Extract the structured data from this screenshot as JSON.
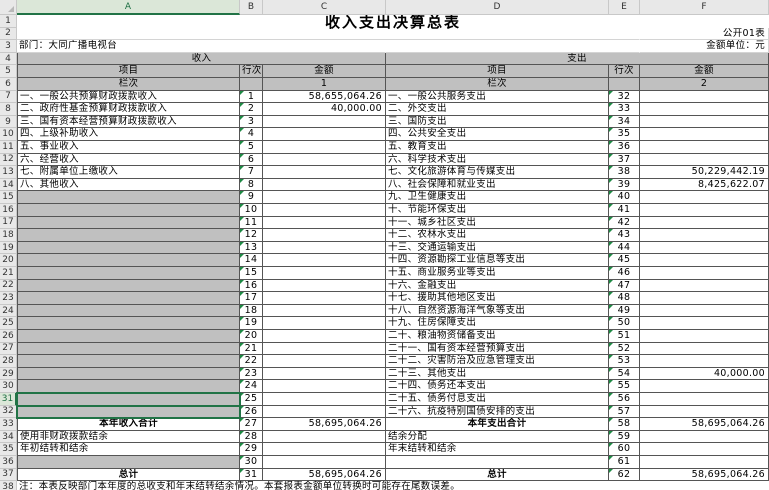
{
  "columns": [
    "A",
    "B",
    "C",
    "D",
    "E",
    "F"
  ],
  "rows": [
    "1",
    "2",
    "3",
    "4",
    "5",
    "6",
    "7",
    "8",
    "9",
    "10",
    "11",
    "12",
    "13",
    "14",
    "15",
    "16",
    "17",
    "18",
    "19",
    "20",
    "21",
    "22",
    "23",
    "24",
    "25",
    "26",
    "27",
    "28",
    "29",
    "30",
    "31",
    "32",
    "33",
    "34",
    "35",
    "36",
    "37",
    "38"
  ],
  "selected_cell": "A31",
  "sheet": {
    "title": "收入支出决算总表",
    "form_code": "公开01表",
    "department": "部门：大同广播电视台",
    "unit": "金额单位：元",
    "income_header": "收入",
    "expense_header": "支出",
    "item_label": "项目",
    "line_label": "行次",
    "amount_label": "金额",
    "column_label": "栏次",
    "income_col_no": "1",
    "expense_col_no": "2",
    "income_rows": [
      {
        "name": "一、一般公共预算财政拨款收入",
        "line": "1",
        "amount": "58,655,064.26"
      },
      {
        "name": "二、政府性基金预算财政拨款收入",
        "line": "2",
        "amount": "40,000.00"
      },
      {
        "name": "三、国有资本经营预算财政拨款收入",
        "line": "3",
        "amount": ""
      },
      {
        "name": "四、上级补助收入",
        "line": "4",
        "amount": ""
      },
      {
        "name": "五、事业收入",
        "line": "5",
        "amount": ""
      },
      {
        "name": "六、经营收入",
        "line": "6",
        "amount": ""
      },
      {
        "name": "七、附属单位上缴收入",
        "line": "7",
        "amount": ""
      },
      {
        "name": "八、其他收入",
        "line": "8",
        "amount": ""
      },
      {
        "name": "",
        "line": "9",
        "amount": ""
      },
      {
        "name": "",
        "line": "10",
        "amount": ""
      },
      {
        "name": "",
        "line": "11",
        "amount": ""
      },
      {
        "name": "",
        "line": "12",
        "amount": ""
      },
      {
        "name": "",
        "line": "13",
        "amount": ""
      },
      {
        "name": "",
        "line": "14",
        "amount": ""
      },
      {
        "name": "",
        "line": "15",
        "amount": ""
      },
      {
        "name": "",
        "line": "16",
        "amount": ""
      },
      {
        "name": "",
        "line": "17",
        "amount": ""
      },
      {
        "name": "",
        "line": "18",
        "amount": ""
      },
      {
        "name": "",
        "line": "19",
        "amount": ""
      },
      {
        "name": "",
        "line": "20",
        "amount": ""
      },
      {
        "name": "",
        "line": "21",
        "amount": ""
      },
      {
        "name": "",
        "line": "22",
        "amount": ""
      },
      {
        "name": "",
        "line": "23",
        "amount": ""
      },
      {
        "name": "",
        "line": "24",
        "amount": ""
      },
      {
        "name": "",
        "line": "25",
        "amount": ""
      },
      {
        "name": "",
        "line": "26",
        "amount": ""
      },
      {
        "name": "本年收入合计",
        "line": "27",
        "amount": "58,695,064.26"
      },
      {
        "name": "使用非财政拨款结余",
        "line": "28",
        "amount": ""
      },
      {
        "name": "年初结转和结余",
        "line": "29",
        "amount": ""
      },
      {
        "name": "",
        "line": "30",
        "amount": ""
      },
      {
        "name": "总计",
        "line": "31",
        "amount": "58,695,064.26"
      }
    ],
    "expense_rows": [
      {
        "name": "一、一般公共服务支出",
        "line": "32",
        "amount": ""
      },
      {
        "name": "二、外交支出",
        "line": "33",
        "amount": ""
      },
      {
        "name": "三、国防支出",
        "line": "34",
        "amount": ""
      },
      {
        "name": "四、公共安全支出",
        "line": "35",
        "amount": ""
      },
      {
        "name": "五、教育支出",
        "line": "36",
        "amount": ""
      },
      {
        "name": "六、科学技术支出",
        "line": "37",
        "amount": ""
      },
      {
        "name": "七、文化旅游体育与传媒支出",
        "line": "38",
        "amount": "50,229,442.19"
      },
      {
        "name": "八、社会保障和就业支出",
        "line": "39",
        "amount": "8,425,622.07"
      },
      {
        "name": "九、卫生健康支出",
        "line": "40",
        "amount": ""
      },
      {
        "name": "十、节能环保支出",
        "line": "41",
        "amount": ""
      },
      {
        "name": "十一、城乡社区支出",
        "line": "42",
        "amount": ""
      },
      {
        "name": "十二、农林水支出",
        "line": "43",
        "amount": ""
      },
      {
        "name": "十三、交通运输支出",
        "line": "44",
        "amount": ""
      },
      {
        "name": "十四、资源勘探工业信息等支出",
        "line": "45",
        "amount": ""
      },
      {
        "name": "十五、商业服务业等支出",
        "line": "46",
        "amount": ""
      },
      {
        "name": "十六、金融支出",
        "line": "47",
        "amount": ""
      },
      {
        "name": "十七、援助其他地区支出",
        "line": "48",
        "amount": ""
      },
      {
        "name": "十八、自然资源海洋气象等支出",
        "line": "49",
        "amount": ""
      },
      {
        "name": "十九、住房保障支出",
        "line": "50",
        "amount": ""
      },
      {
        "name": "二十、粮油物资储备支出",
        "line": "51",
        "amount": ""
      },
      {
        "name": "二十一、国有资本经营预算支出",
        "line": "52",
        "amount": ""
      },
      {
        "name": "二十二、灾害防治及应急管理支出",
        "line": "53",
        "amount": ""
      },
      {
        "name": "二十三、其他支出",
        "line": "54",
        "amount": "40,000.00"
      },
      {
        "name": "二十四、债务还本支出",
        "line": "55",
        "amount": ""
      },
      {
        "name": "二十五、债务付息支出",
        "line": "56",
        "amount": ""
      },
      {
        "name": "二十六、抗疫特别国债安排的支出",
        "line": "57",
        "amount": ""
      },
      {
        "name": "本年支出合计",
        "line": "58",
        "amount": "58,695,064.26"
      },
      {
        "name": "结余分配",
        "line": "59",
        "amount": ""
      },
      {
        "name": "年末结转和结余",
        "line": "60",
        "amount": ""
      },
      {
        "name": "",
        "line": "61",
        "amount": ""
      },
      {
        "name": "总计",
        "line": "62",
        "amount": "58,695,064.26"
      }
    ],
    "note": "注：本表反映部门本年度的总收支和年末结转结余情况。本套报表金额单位转换时可能存在尾数误差。"
  }
}
